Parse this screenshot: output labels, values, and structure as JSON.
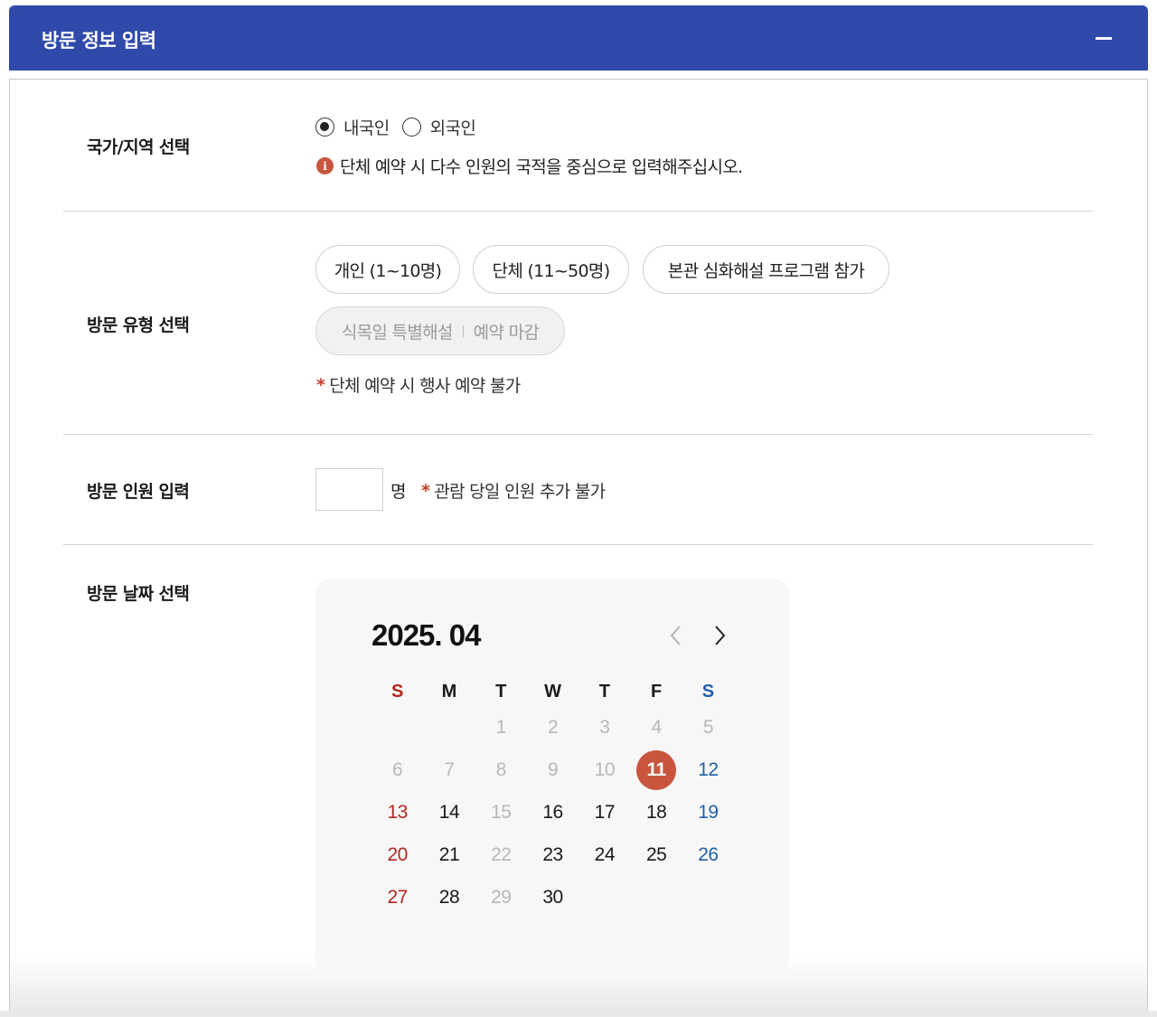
{
  "header": {
    "title": "방문 정보 입력",
    "collapse_icon": "minus-icon"
  },
  "nationality": {
    "label": "국가/지역 선택",
    "options": [
      {
        "label": "내국인",
        "checked": true
      },
      {
        "label": "외국인",
        "checked": false
      }
    ],
    "info_icon_glyph": "i",
    "notice": "단체 예약 시 다수 인원의 국적을 중심으로 입력해주십시오."
  },
  "visit_type": {
    "label": "방문 유형 선택",
    "options": [
      {
        "label": "개인 (1~10명)"
      },
      {
        "label": "단체 (11~50명)"
      },
      {
        "label": "본관 심화해설 프로그램 참가"
      }
    ],
    "special": {
      "label": "식목일 특별해설",
      "status": "예약 마감"
    },
    "note_star": "*",
    "note": "단체 예약 시 행사 예약 불가"
  },
  "headcount": {
    "label": "방문 인원 입력",
    "value": "",
    "unit": "명",
    "note_star": "*",
    "note": "관람 당일 인원 추가 불가"
  },
  "visit_date": {
    "label": "방문 날짜 선택",
    "calendar": {
      "title": "2025. 04",
      "weekdays": [
        "S",
        "M",
        "T",
        "W",
        "T",
        "F",
        "S"
      ],
      "weeks": [
        [
          "",
          "",
          "1",
          "2",
          "3",
          "4",
          "5"
        ],
        [
          "6",
          "7",
          "8",
          "9",
          "10",
          "11",
          "12"
        ],
        [
          "13",
          "14",
          "15",
          "16",
          "17",
          "18",
          "19"
        ],
        [
          "20",
          "21",
          "22",
          "23",
          "24",
          "25",
          "26"
        ],
        [
          "27",
          "28",
          "29",
          "30",
          "",
          "",
          ""
        ]
      ],
      "disabled_days": [
        "1",
        "2",
        "3",
        "4",
        "5",
        "6",
        "7",
        "8",
        "9",
        "10",
        "15",
        "22",
        "29"
      ],
      "selected_day": "11",
      "colors": {
        "sunday": "#b3261e",
        "saturday": "#1f5fa8",
        "selected": "#c9553f",
        "disabled": "#b8b8b8"
      }
    }
  },
  "theme": {
    "header_bg": "#2f4aab",
    "accent": "#c9553f"
  }
}
